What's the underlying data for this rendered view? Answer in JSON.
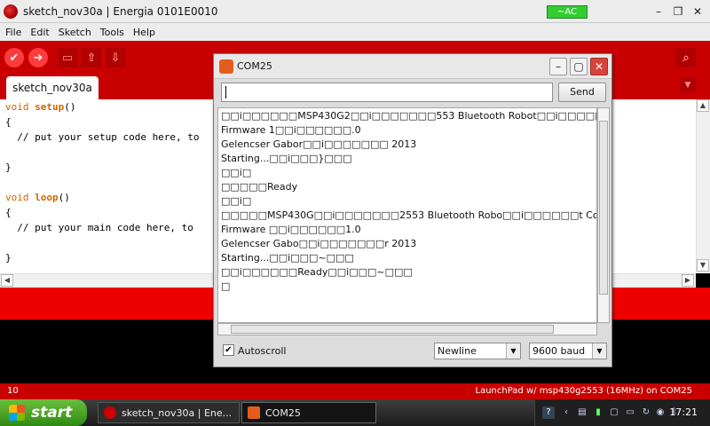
{
  "window": {
    "title": "sketch_nov30a | Energia 0101E0010",
    "power_badge": "~AC",
    "minimize": "–",
    "restore": "❐",
    "close": "✕"
  },
  "menu": [
    "File",
    "Edit",
    "Sketch",
    "Tools",
    "Help"
  ],
  "toolbar": {
    "verify_icon": "check-icon",
    "upload_icon": "arrow-right-icon",
    "new_icon": "page-icon",
    "open_icon": "arrow-up-icon",
    "save_icon": "arrow-down-icon",
    "serial_icon": "magnifier-icon"
  },
  "tab": {
    "label": "sketch_nov30a",
    "menu_glyph": "▼"
  },
  "code": {
    "line1_kw": "void",
    "line1_fn": "setup",
    "line1_rest": "()",
    "line2": "{",
    "line3": "  // put your setup code here, to",
    "line4": "}",
    "line5_kw": "void",
    "line5_fn": "loop",
    "line5_rest": "()",
    "line6": "{",
    "line7": "  // put your main code here, to",
    "line8": "}"
  },
  "status": {
    "line_number": "10",
    "board": "LaunchPad w/ msp430g2553 (16MHz) on COM25"
  },
  "serial_monitor": {
    "title": "COM25",
    "send_label": "Send",
    "input_value": "",
    "output_lines": [
      "□□i□□□□□□MSP430G2□□i□□□□□□□553 Bluetooth Robot□□i□□□□□□ C",
      "Firmware 1□□i□□□□□□.0",
      "Gelencser Gabor□□i□□□□□□□ 2013",
      "Starting...□□i□□□}□□□",
      "□□i□",
      "□□□□□Ready",
      "□□i□",
      "□□□□□MSP430G□□i□□□□□□□2553 Bluetooth Robo□□i□□□□□□t Contro",
      "Firmware □□i□□□□□□1.0",
      "Gelencser Gabo□□i□□□□□□□r 2013",
      "Starting...□□i□□□~□□□",
      "□□i□□□□□□Ready□□i□□□~□□□",
      "□"
    ],
    "autoscroll_label": "Autoscroll",
    "autoscroll_checked": true,
    "line_ending": "Newline",
    "baud": "9600 baud"
  },
  "taskbar": {
    "start_label": "start",
    "tasks": [
      "sketch_nov30a | Ene...",
      "COM25"
    ],
    "clock": "17:21"
  }
}
